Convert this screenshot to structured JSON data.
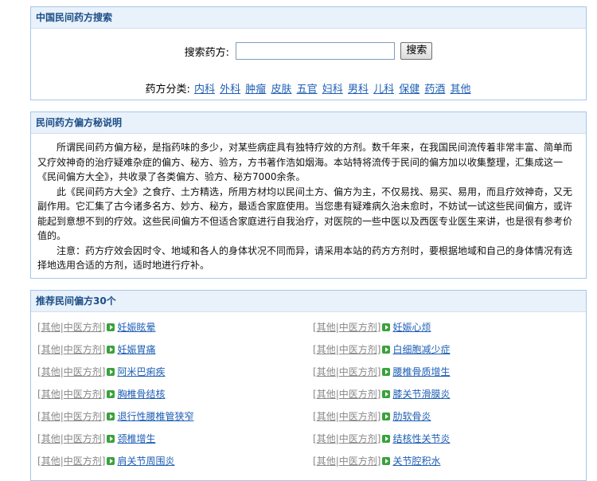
{
  "search_panel": {
    "title": "中国民间药方搜索",
    "search_label": "搜索药方:",
    "search_value": "",
    "search_button": "搜索",
    "category_label": "药方分类:",
    "categories": [
      "内科",
      "外科",
      "肿瘤",
      "皮肤",
      "五官",
      "妇科",
      "男科",
      "儿科",
      "保健",
      "药酒",
      "其他"
    ]
  },
  "desc_panel": {
    "title": "民间药方偏方秘说明",
    "paragraphs": [
      "所谓民间药方偏方秘，是指药味的多少，对某些病症具有独特疗效的方剂。数千年来，在我国民间流传着非常丰富、简单而又疗效神奇的治疗疑难杂症的偏方、秘方、验方，方书著作浩如烟海。本站特将流传于民间的偏方加以收集整理，汇集成这一《民间偏方大全》，共收录了各类偏方、验方、秘方7000余条。",
      "此《民间药方大全》之食疗、土方精选，所用方材均以民间土方、偏方为主，不仅易找、易买、易用，而且疗效神奇，又无副作用。它汇集了古今诸多名方、妙方、秘方，最适合家庭使用。当您患有疑难病久治未愈时，不妨试一试这些民间偏方，或许能起到意想不到的疗效。这些民间偏方不但适合家庭进行自我治疗，对医院的一些中医以及西医专业医生来讲，也是很有参考价值的。",
      "注意：药方疗效会因时令、地域和各人的身体状况不同而异，请采用本站的药方方剂时，要根据地域和自己的身体情况有选择地选用合适的方剂，适时地进行疗补。"
    ]
  },
  "recommend_panel": {
    "title": "推荐民间偏方30个",
    "tag_open": "[",
    "tag_a": "其他",
    "tag_sep": "|",
    "tag_b": "中医方剂",
    "tag_close": "]",
    "left": [
      "妊娠眩晕",
      "妊娠胃痛",
      "阿米巴痢疾",
      "胸椎骨结核",
      "退行性腰椎管狭窄",
      "颈椎增生",
      "肩关节周围炎"
    ],
    "right": [
      "妊娠心烦",
      "白细胞减少症",
      "腰椎骨质增生",
      "膝关节滑膜炎",
      "肋软骨炎",
      "结核性关节炎",
      "关节腔积水"
    ]
  }
}
